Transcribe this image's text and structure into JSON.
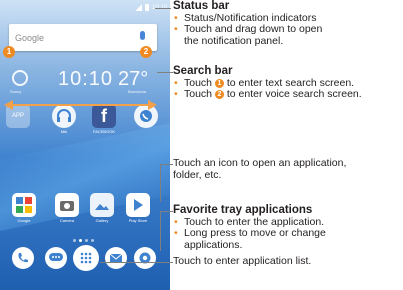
{
  "phone": {
    "search_label": "Google",
    "num_1": "1",
    "num_2": "2",
    "weather_city": "Sunny",
    "clock": "10:10",
    "temperature": "27°",
    "weather_place": "Barcelona",
    "row1": [
      "APP",
      "",
      "",
      ""
    ],
    "row1_labels": [
      "",
      "Mtk",
      "FACEBOOK",
      ""
    ],
    "row2_labels": [
      "Google",
      "Camera",
      "Gallery",
      "Play Store"
    ]
  },
  "annotations": {
    "status_bar": {
      "title": "Status bar",
      "bullets": [
        "Status/Notification indicators",
        "Touch and drag down to open",
        "the notification panel."
      ]
    },
    "search_bar": {
      "title": "Search bar",
      "bullet1_pre": "Touch ",
      "bullet1_num": "1",
      "bullet1_post": " to enter text search screen.",
      "bullet2_pre": "Touch ",
      "bullet2_num": "2",
      "bullet2_post": " to enter voice search screen."
    },
    "icon_touch": [
      "Touch an icon to open an application,",
      "folder, etc."
    ],
    "favorite": {
      "title": "Favorite tray applications",
      "bullets": [
        "Touch to enter the application.",
        "Long press to move or change",
        "applications."
      ]
    },
    "app_list": "Touch to enter application list."
  },
  "colors": {
    "accent": "#ef8a22",
    "leader": "#7f7f7f"
  }
}
